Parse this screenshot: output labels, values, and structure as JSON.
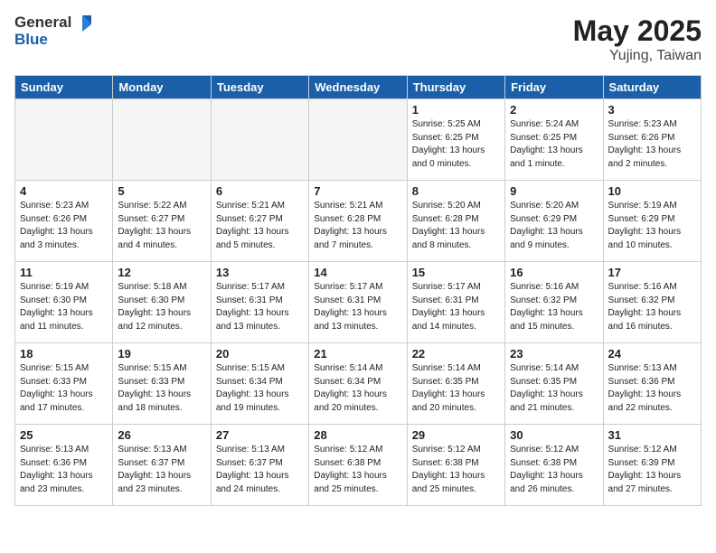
{
  "header": {
    "logo_general": "General",
    "logo_blue": "Blue",
    "title": "May 2025",
    "location": "Yujing, Taiwan"
  },
  "weekdays": [
    "Sunday",
    "Monday",
    "Tuesday",
    "Wednesday",
    "Thursday",
    "Friday",
    "Saturday"
  ],
  "weeks": [
    [
      {
        "day": "",
        "info": ""
      },
      {
        "day": "",
        "info": ""
      },
      {
        "day": "",
        "info": ""
      },
      {
        "day": "",
        "info": ""
      },
      {
        "day": "1",
        "info": "Sunrise: 5:25 AM\nSunset: 6:25 PM\nDaylight: 13 hours\nand 0 minutes."
      },
      {
        "day": "2",
        "info": "Sunrise: 5:24 AM\nSunset: 6:25 PM\nDaylight: 13 hours\nand 1 minute."
      },
      {
        "day": "3",
        "info": "Sunrise: 5:23 AM\nSunset: 6:26 PM\nDaylight: 13 hours\nand 2 minutes."
      }
    ],
    [
      {
        "day": "4",
        "info": "Sunrise: 5:23 AM\nSunset: 6:26 PM\nDaylight: 13 hours\nand 3 minutes."
      },
      {
        "day": "5",
        "info": "Sunrise: 5:22 AM\nSunset: 6:27 PM\nDaylight: 13 hours\nand 4 minutes."
      },
      {
        "day": "6",
        "info": "Sunrise: 5:21 AM\nSunset: 6:27 PM\nDaylight: 13 hours\nand 5 minutes."
      },
      {
        "day": "7",
        "info": "Sunrise: 5:21 AM\nSunset: 6:28 PM\nDaylight: 13 hours\nand 7 minutes."
      },
      {
        "day": "8",
        "info": "Sunrise: 5:20 AM\nSunset: 6:28 PM\nDaylight: 13 hours\nand 8 minutes."
      },
      {
        "day": "9",
        "info": "Sunrise: 5:20 AM\nSunset: 6:29 PM\nDaylight: 13 hours\nand 9 minutes."
      },
      {
        "day": "10",
        "info": "Sunrise: 5:19 AM\nSunset: 6:29 PM\nDaylight: 13 hours\nand 10 minutes."
      }
    ],
    [
      {
        "day": "11",
        "info": "Sunrise: 5:19 AM\nSunset: 6:30 PM\nDaylight: 13 hours\nand 11 minutes."
      },
      {
        "day": "12",
        "info": "Sunrise: 5:18 AM\nSunset: 6:30 PM\nDaylight: 13 hours\nand 12 minutes."
      },
      {
        "day": "13",
        "info": "Sunrise: 5:17 AM\nSunset: 6:31 PM\nDaylight: 13 hours\nand 13 minutes."
      },
      {
        "day": "14",
        "info": "Sunrise: 5:17 AM\nSunset: 6:31 PM\nDaylight: 13 hours\nand 13 minutes."
      },
      {
        "day": "15",
        "info": "Sunrise: 5:17 AM\nSunset: 6:31 PM\nDaylight: 13 hours\nand 14 minutes."
      },
      {
        "day": "16",
        "info": "Sunrise: 5:16 AM\nSunset: 6:32 PM\nDaylight: 13 hours\nand 15 minutes."
      },
      {
        "day": "17",
        "info": "Sunrise: 5:16 AM\nSunset: 6:32 PM\nDaylight: 13 hours\nand 16 minutes."
      }
    ],
    [
      {
        "day": "18",
        "info": "Sunrise: 5:15 AM\nSunset: 6:33 PM\nDaylight: 13 hours\nand 17 minutes."
      },
      {
        "day": "19",
        "info": "Sunrise: 5:15 AM\nSunset: 6:33 PM\nDaylight: 13 hours\nand 18 minutes."
      },
      {
        "day": "20",
        "info": "Sunrise: 5:15 AM\nSunset: 6:34 PM\nDaylight: 13 hours\nand 19 minutes."
      },
      {
        "day": "21",
        "info": "Sunrise: 5:14 AM\nSunset: 6:34 PM\nDaylight: 13 hours\nand 20 minutes."
      },
      {
        "day": "22",
        "info": "Sunrise: 5:14 AM\nSunset: 6:35 PM\nDaylight: 13 hours\nand 20 minutes."
      },
      {
        "day": "23",
        "info": "Sunrise: 5:14 AM\nSunset: 6:35 PM\nDaylight: 13 hours\nand 21 minutes."
      },
      {
        "day": "24",
        "info": "Sunrise: 5:13 AM\nSunset: 6:36 PM\nDaylight: 13 hours\nand 22 minutes."
      }
    ],
    [
      {
        "day": "25",
        "info": "Sunrise: 5:13 AM\nSunset: 6:36 PM\nDaylight: 13 hours\nand 23 minutes."
      },
      {
        "day": "26",
        "info": "Sunrise: 5:13 AM\nSunset: 6:37 PM\nDaylight: 13 hours\nand 23 minutes."
      },
      {
        "day": "27",
        "info": "Sunrise: 5:13 AM\nSunset: 6:37 PM\nDaylight: 13 hours\nand 24 minutes."
      },
      {
        "day": "28",
        "info": "Sunrise: 5:12 AM\nSunset: 6:38 PM\nDaylight: 13 hours\nand 25 minutes."
      },
      {
        "day": "29",
        "info": "Sunrise: 5:12 AM\nSunset: 6:38 PM\nDaylight: 13 hours\nand 25 minutes."
      },
      {
        "day": "30",
        "info": "Sunrise: 5:12 AM\nSunset: 6:38 PM\nDaylight: 13 hours\nand 26 minutes."
      },
      {
        "day": "31",
        "info": "Sunrise: 5:12 AM\nSunset: 6:39 PM\nDaylight: 13 hours\nand 27 minutes."
      }
    ]
  ]
}
